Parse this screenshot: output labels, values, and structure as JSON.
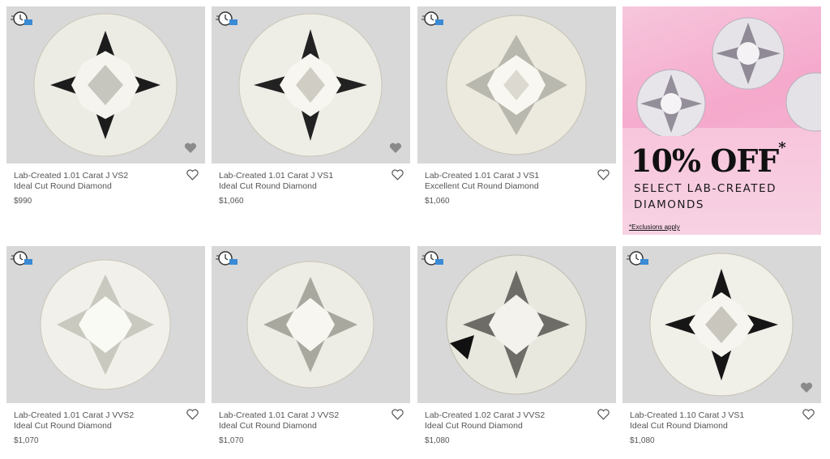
{
  "listings": [
    {
      "line1": "Lab-Created 1.01 Carat J VS2",
      "line2": "Ideal Cut Round Diamond",
      "price": "$990"
    },
    {
      "line1": "Lab-Created 1.01 Carat J VS1",
      "line2": "Ideal Cut Round Diamond",
      "price": "$1,060"
    },
    {
      "line1": "Lab-Created 1.01 Carat J VS1",
      "line2": "Excellent Cut Round Diamond",
      "price": "$1,060"
    },
    {
      "line1": "Lab-Created 1.01 Carat J VVS2",
      "line2": "Ideal Cut Round Diamond",
      "price": "$1,070"
    },
    {
      "line1": "Lab-Created 1.01 Carat J VVS2",
      "line2": "Ideal Cut Round Diamond",
      "price": "$1,070"
    },
    {
      "line1": "Lab-Created 1.02 Carat J VVS2",
      "line2": "Ideal Cut Round Diamond",
      "price": "$1,080"
    },
    {
      "line1": "Lab-Created 1.10 Carat J VS1",
      "line2": "Ideal Cut Round Diamond",
      "price": "$1,080"
    }
  ],
  "promo": {
    "headline": "10% OFF",
    "asterisk": "*",
    "sub_line1": "SELECT LAB-CREATED",
    "sub_line2": "DIAMONDS",
    "fine_print": "*Exclusions apply"
  },
  "icons": {
    "shipping": "fast-shipping-clock-truck-icon",
    "favorite": "heart-outline-icon",
    "favorite_image": "heart-filled-icon"
  },
  "colors": {
    "tile_background": "#d8d8d8",
    "text": "#555555",
    "promo_pink": "#f5a9cc"
  }
}
